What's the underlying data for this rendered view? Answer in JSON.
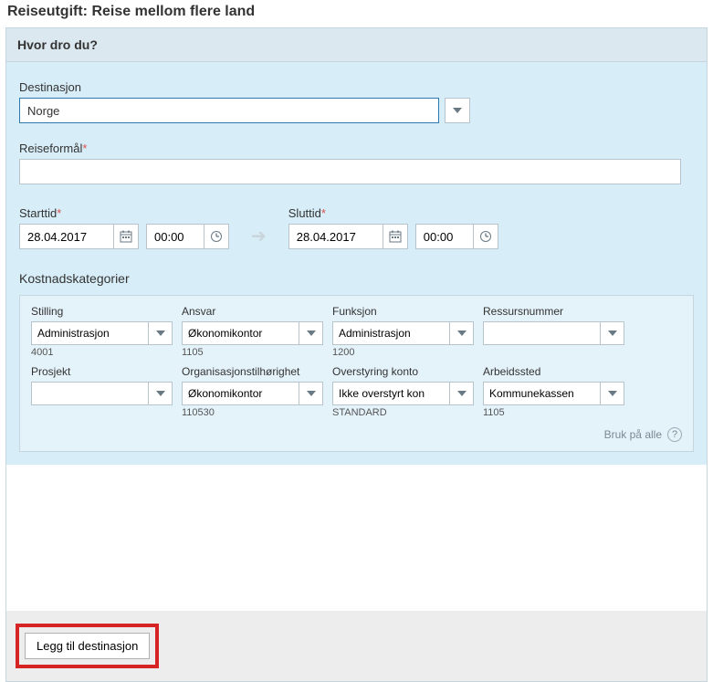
{
  "pageTitle": "Reiseutgift: Reise mellom flere land",
  "section": {
    "header": "Hvor dro du?",
    "destLabel": "Destinasjon",
    "destValue": "Norge",
    "purposeLabel": "Reiseformål",
    "purposeValue": "",
    "startLabel": "Starttid",
    "startDate": "28.04.2017",
    "startTime": "00:00",
    "endLabel": "Sluttid",
    "endDate": "28.04.2017",
    "endTime": "00:00"
  },
  "cost": {
    "title": "Kostnadskategorier",
    "applyAll": "Bruk på alle",
    "row1": [
      {
        "label": "Stilling",
        "value": "Administrasjon",
        "sub": "4001"
      },
      {
        "label": "Ansvar",
        "value": "Økonomikontor",
        "sub": "1105"
      },
      {
        "label": "Funksjon",
        "value": "Administrasjon",
        "sub": "1200"
      },
      {
        "label": "Ressursnummer",
        "value": "",
        "sub": ""
      }
    ],
    "row2": [
      {
        "label": "Prosjekt",
        "value": "",
        "sub": ""
      },
      {
        "label": "Organisasjonstilhørighet",
        "value": "Økonomikontor",
        "sub": "110530"
      },
      {
        "label": "Overstyring konto",
        "value": "Ikke overstyrt kon",
        "sub": "STANDARD"
      },
      {
        "label": "Arbeidssted",
        "value": "Kommunekassen",
        "sub": "1105"
      }
    ]
  },
  "footer": {
    "addDest": "Legg til destinasjon"
  }
}
